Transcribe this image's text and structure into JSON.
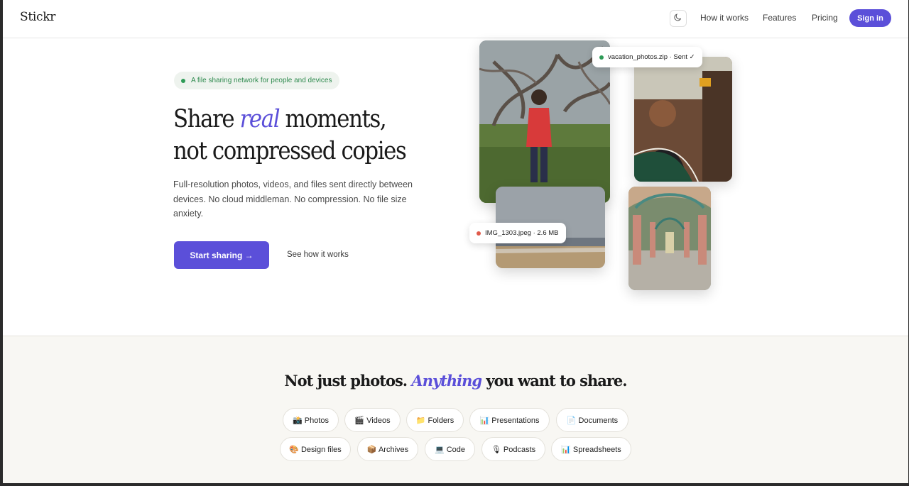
{
  "header": {
    "logo": "Stickr",
    "nav": [
      "How it works",
      "Features",
      "Pricing"
    ],
    "signin": "Sign in",
    "theme_icon": "moon-icon"
  },
  "hero": {
    "pill": "A file sharing network for people and devices",
    "headline_a": "Share",
    "headline_em": "real",
    "headline_b": "moments,",
    "headline_line2": "not compressed copies",
    "subtext": "Full-resolution photos, videos, and files sent directly between devices. No cloud middleman. No compression. No file size anxiety.",
    "cta": "Start sharing →",
    "secondary": "See how it works"
  },
  "chips": {
    "zip": "vacation_photos.zip · Sent ✓",
    "img": "IMG_1303.jpeg · 2.6 MB"
  },
  "lower": {
    "title_a": "Not just photos.",
    "title_em": "Anything",
    "title_b": "you want to share.",
    "tags_row1": [
      "📸 Photos",
      "🎬 Videos",
      "📁 Folders",
      "📊 Presentations",
      "📄 Documents"
    ],
    "tags_row2": [
      "🎨 Design files",
      "📦 Archives",
      "💻 Code",
      "🎙 Podcasts",
      "📊 Spreadsheets"
    ]
  },
  "colors": {
    "accent": "#5b4fd9",
    "green_dot": "#2e9b57",
    "red_dot": "#e05a4a"
  }
}
